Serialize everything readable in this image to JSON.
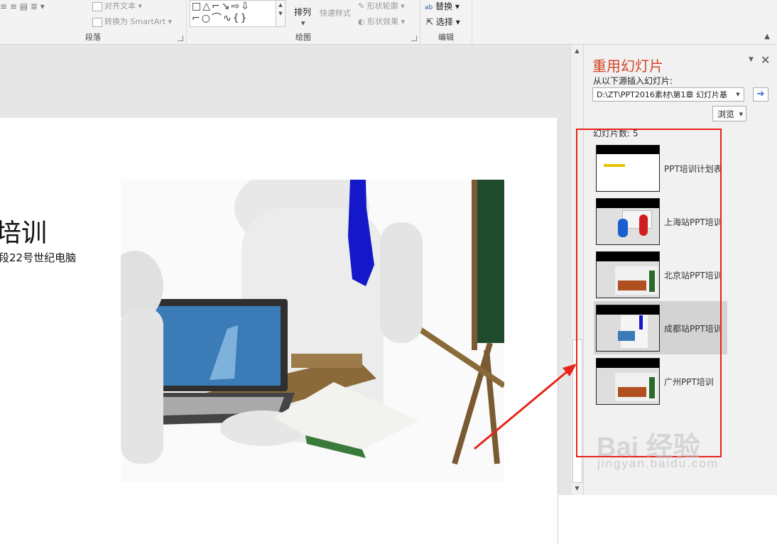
{
  "ribbon": {
    "paragraph": {
      "label": "段落",
      "align_text": "对齐文本",
      "convert_smartart": "转换为 SmartArt"
    },
    "drawing": {
      "label": "绘图",
      "shapes_row1": "□△⌐↘⇨⇩",
      "shapes_row2": "⌐○⌒∿{}",
      "arrange": "排列",
      "quick_styles": "快速样式",
      "shape_outline": "形状轮廓",
      "shape_effects": "形状效果"
    },
    "editing": {
      "label": "编辑",
      "replace": "替换",
      "select": "选择"
    }
  },
  "slide": {
    "title": "培训",
    "subtitle": "段22号世纪电脑"
  },
  "pane": {
    "title": "重用幻灯片",
    "source_label": "从以下源插入幻灯片:",
    "source_path": "D:\\ZT\\PPT2016素材\\第1章 幻灯片基",
    "browse": "浏览",
    "slide_count": "幻灯片数: 5",
    "slides": [
      {
        "label": "PPT培训计划表",
        "selected": false
      },
      {
        "label": "上海站PPT培训",
        "selected": false
      },
      {
        "label": "北京站PPT培训",
        "selected": false
      },
      {
        "label": "成都站PPT培训",
        "selected": true
      },
      {
        "label": "广州PPT培训",
        "selected": false
      }
    ]
  },
  "watermark": {
    "logo": "Bai 经验",
    "url": "jingyan.baidu.com"
  },
  "colors": {
    "pane_title": "#d24726",
    "annotation": "#e8231a"
  }
}
